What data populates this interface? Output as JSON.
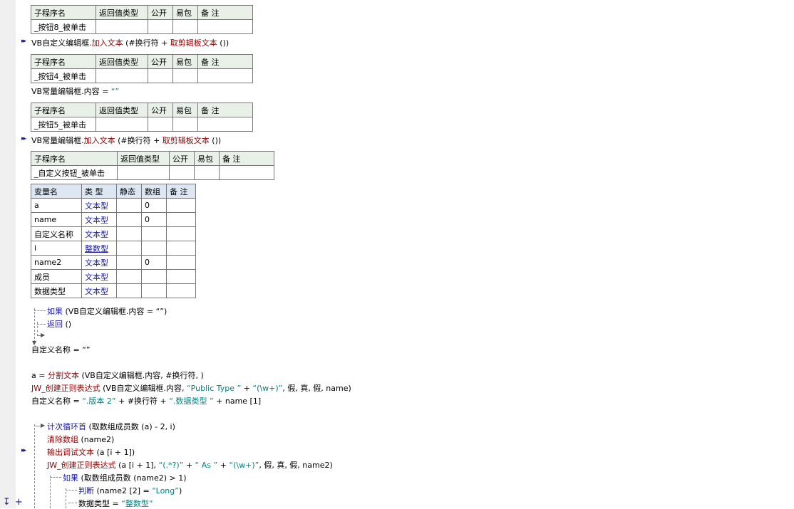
{
  "sub_header": {
    "name": "子程序名",
    "ret": "返回值类型",
    "public": "公开",
    "easy": "易包",
    "note": "备 注"
  },
  "subs": [
    {
      "name": "_按钮8_被单击"
    },
    {
      "name": "_按钮4_被单击"
    },
    {
      "name": "_按钮5_被单击"
    },
    {
      "name": "_自定义按钮_被单击"
    }
  ],
  "code_a": {
    "obj": "VB自定义编辑框",
    "dot": ".",
    "fn": "加入文本",
    "args": " (#换行符 + ",
    "fn2": "取剪辑板文本",
    "end": " ())"
  },
  "code_b": {
    "lhs": "VB常量编辑框.内容 = ",
    "str": "“”"
  },
  "code_c": {
    "obj": "VB常量编辑框",
    "dot": ".",
    "fn": "加入文本",
    "args": " (#换行符 + ",
    "fn2": "取剪辑板文本",
    "end": " ())"
  },
  "var_header": {
    "name": "变量名",
    "type": "类 型",
    "static": "静态",
    "array": "数组",
    "note": "备 注"
  },
  "vars": [
    {
      "name": "a",
      "type": "文本型",
      "array": "0"
    },
    {
      "name": "name",
      "type": "文本型",
      "array": "0"
    },
    {
      "name": "自定义名称",
      "type": "文本型",
      "array": ""
    },
    {
      "name": "i",
      "type": "整数型",
      "array": ""
    },
    {
      "name": "name2",
      "type": "文本型",
      "array": "0"
    },
    {
      "name": "成员",
      "type": "文本型",
      "array": ""
    },
    {
      "name": "数据类型",
      "type": "文本型",
      "array": ""
    }
  ],
  "lines": {
    "if1_kw": "如果",
    "if1_rest": " (VB自定义编辑框.内容 = “”)",
    "ret_kw": "返回",
    "ret_rest": " ()",
    "assign1": "自定义名称 = “”",
    "split_lhs": "a = ",
    "split_fn": "分割文本",
    "split_rest": " (VB自定义编辑框.内容, #换行符, )",
    "regex_fn": "JW_创建正则表达式",
    "regex_rest1": " (VB自定义编辑框.内容, ",
    "regex_str1": "“Public Type ”",
    "regex_rest2": " + ",
    "regex_str2": "“(\\w+)”",
    "regex_rest3": ", 假, 真, 假, name)",
    "assign2_lhs": "自定义名称 = ",
    "assign2_str1": "“.版本 2”",
    "assign2_mid": " + #换行符 + ",
    "assign2_str2": "“.数据类型 ”",
    "assign2_end": " + name [1]",
    "loop_kw": "计次循环首",
    "loop_rest": " (取数组成员数 (a) - 2, i)",
    "clear_fn": "清除数组",
    "clear_rest": " (name2)",
    "debug_fn": "输出调试文本",
    "debug_rest": " (a [i + 1])",
    "regex2_fn": "JW_创建正则表达式",
    "regex2_rest1": " (a [i + 1], ",
    "regex2_str1": "“(.*?)”",
    "regex2_plus1": " + ",
    "regex2_str2": "“ As ”",
    "regex2_plus2": " + ",
    "regex2_str3": "“(\\w+)”",
    "regex2_rest2": ", 假, 真, 假, name2)",
    "if2_kw": "如果",
    "if2_rest": " (取数组成员数 (name2) > 1)",
    "judge_kw": "判断",
    "judge_rest": " (name2 [2] = ",
    "judge_str": "“Long”",
    "judge_end": ")",
    "dtype_lhs": "数据类型 = ",
    "dtype_str": "“整数型”"
  },
  "icons": [
    "breakpoint-arrow-icon",
    "expand-plus-icon",
    "step-into-icon"
  ]
}
